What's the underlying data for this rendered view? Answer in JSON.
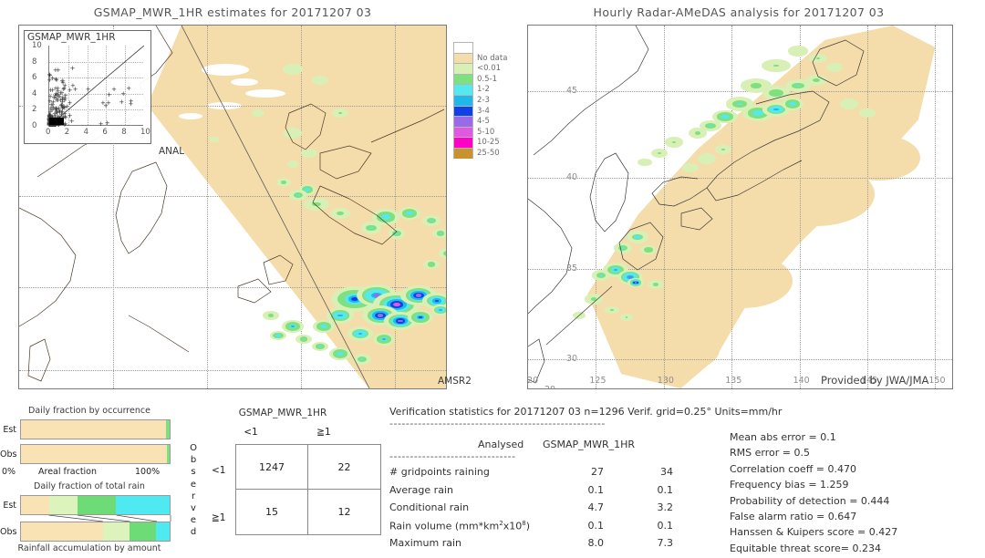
{
  "left_panel": {
    "title": "GSMAP_MWR_1HR estimates for 20171207 03",
    "corner_tag": "AMSR2",
    "anal_tag": "ANAL",
    "inset": {
      "title": "GSMAP_MWR_1HR",
      "y_ticks": [
        "10",
        "8",
        "6",
        "4",
        "2",
        "0"
      ],
      "x_ticks": [
        "0",
        "2",
        "4",
        "6",
        "8",
        "10"
      ]
    }
  },
  "right_panel": {
    "title": "Hourly Radar-AMeDAS analysis for 20171207 03",
    "provider": "Provided by JWA/JMA",
    "lat_ticks": [
      "45",
      "40",
      "35",
      "30"
    ],
    "lon_ticks": [
      "120",
      "125",
      "130",
      "135",
      "140",
      "145",
      "150"
    ],
    "lon_corner": "20"
  },
  "legend": {
    "entries": [
      {
        "label": "",
        "color": "#ffffff"
      },
      {
        "label": "No data",
        "color": "#f5dcab"
      },
      {
        "label": "<0.01",
        "color": "#d8f0b6"
      },
      {
        "label": "0.5-1",
        "color": "#7fe07f"
      },
      {
        "label": "1-2",
        "color": "#55e8ec"
      },
      {
        "label": "2-3",
        "color": "#1fb8e8"
      },
      {
        "label": "3-4",
        "color": "#1040e8"
      },
      {
        "label": "4-5",
        "color": "#9a6ae8"
      },
      {
        "label": "5-10",
        "color": "#e05ae0"
      },
      {
        "label": "10-25",
        "color": "#ff00c8"
      },
      {
        "label": "25-50",
        "color": "#c8932e"
      }
    ]
  },
  "bar_charts": [
    {
      "title": "Daily fraction by occurrence",
      "axis_label": "Areal fraction",
      "axis_min": "0%",
      "axis_max": "100%",
      "rows": [
        {
          "label": "Est",
          "segments": [
            {
              "color": "#f9e3b4",
              "pct": 97.5
            },
            {
              "color": "#7fe07f",
              "pct": 2.5
            }
          ]
        },
        {
          "label": "Obs",
          "segments": [
            {
              "color": "#f9e3b4",
              "pct": 98.1
            },
            {
              "color": "#7fe07f",
              "pct": 1.9
            }
          ]
        }
      ]
    },
    {
      "title": "Daily fraction of total rain",
      "axis_label": "Rainfall accumulation by amount",
      "rows": [
        {
          "label": "Est",
          "segments": [
            {
              "color": "#f9e3b4",
              "pct": 19
            },
            {
              "color": "#ddf3bc",
              "pct": 19
            },
            {
              "color": "#6ddc77",
              "pct": 26
            },
            {
              "color": "#4fe9f2",
              "pct": 36
            }
          ]
        },
        {
          "label": "Obs",
          "segments": [
            {
              "color": "#f9e3b4",
              "pct": 55
            },
            {
              "color": "#ddf3bc",
              "pct": 18
            },
            {
              "color": "#6ddc77",
              "pct": 18
            },
            {
              "color": "#4fe9f2",
              "pct": 9
            }
          ]
        }
      ]
    }
  ],
  "contingency": {
    "title": "GSMAP_MWR_1HR",
    "col_headers": [
      "<1",
      "≧1"
    ],
    "row_headers": [
      "<1",
      "≧1"
    ],
    "observed_label": "Observed",
    "cells": [
      "1247",
      "22",
      "15",
      "12"
    ]
  },
  "stats": {
    "header": "Verification statistics for 20171207 03   n=1296   Verif. grid=0.25°   Units=mm/hr",
    "rule_long": "-----------------------------------------------------",
    "rule_short": "-------------------------------",
    "col_headers": [
      "Analysed",
      "GSMAP_MWR_1HR"
    ],
    "rows": [
      {
        "label": "# gridpoints raining",
        "analysed": "27",
        "estimate": "34"
      },
      {
        "label": "Average rain",
        "analysed": "0.1",
        "estimate": "0.1"
      },
      {
        "label": "Conditional rain",
        "analysed": "4.7",
        "estimate": "3.2"
      },
      {
        "label": "Rain volume (mm*km²x10⁸)",
        "analysed": "0.1",
        "estimate": "0.1"
      },
      {
        "label": "Maximum rain",
        "analysed": "8.0",
        "estimate": "7.3"
      }
    ],
    "scores": [
      "Mean abs error =  0.1",
      "RMS error =  0.5",
      "Correlation coeff =  0.470",
      "Frequency bias =  1.259",
      "Probability of detection =  0.444",
      "False alarm ratio =  0.647",
      "Hanssen & Kuipers score =  0.427",
      "Equitable threat score=  0.234"
    ]
  }
}
